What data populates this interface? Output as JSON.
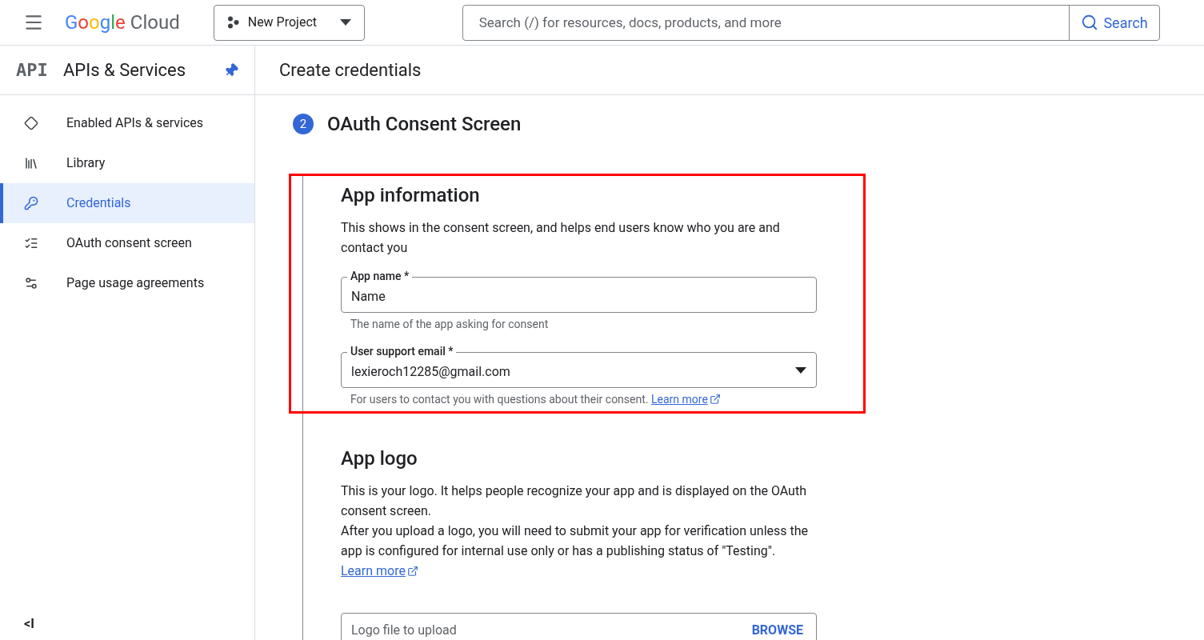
{
  "topbar": {
    "logo": {
      "brand": "Google",
      "product": "Cloud"
    },
    "project": "New Project",
    "search": {
      "placeholder": "Search (/) for resources, docs, products, and more",
      "button": "Search"
    }
  },
  "sidebar": {
    "badge": "API",
    "title": "APIs & Services",
    "pinned": true,
    "items": [
      {
        "label": "Enabled APIs & services",
        "selected": false
      },
      {
        "label": "Library",
        "selected": false
      },
      {
        "label": "Credentials",
        "selected": true
      },
      {
        "label": "OAuth consent screen",
        "selected": false
      },
      {
        "label": "Page usage agreements",
        "selected": false
      }
    ],
    "collapse": "<I"
  },
  "page_title": "Create credentials",
  "step": {
    "number": "2",
    "title": "OAuth Consent Screen"
  },
  "sections": [
    {
      "title": "App information",
      "highlighted": true,
      "paragraphs": [
        "This shows in the consent screen, and helps end users know who you are and contact you"
      ],
      "fields": [
        {
          "kind": "text",
          "label": "App name *",
          "value": "Name",
          "hint": "The name of the app asking for consent"
        },
        {
          "kind": "select",
          "label": "User support email *",
          "value": "lexieroch12285@gmail.com",
          "hint": "For users to contact you with questions about their consent.",
          "link": "Learn more"
        }
      ]
    },
    {
      "title": "App logo",
      "highlighted": false,
      "paragraphs": [
        "This is your logo. It helps people recognize your app and is displayed on the OAuth consent screen.",
        "After you upload a logo, you will need to submit your app for verification unless the app is configured for internal use only or has a publishing status of \"Testing\"."
      ],
      "link": "Learn more",
      "fields": [
        {
          "kind": "file",
          "placeholder": "Logo file to upload",
          "button": "BROWSE"
        }
      ]
    }
  ]
}
